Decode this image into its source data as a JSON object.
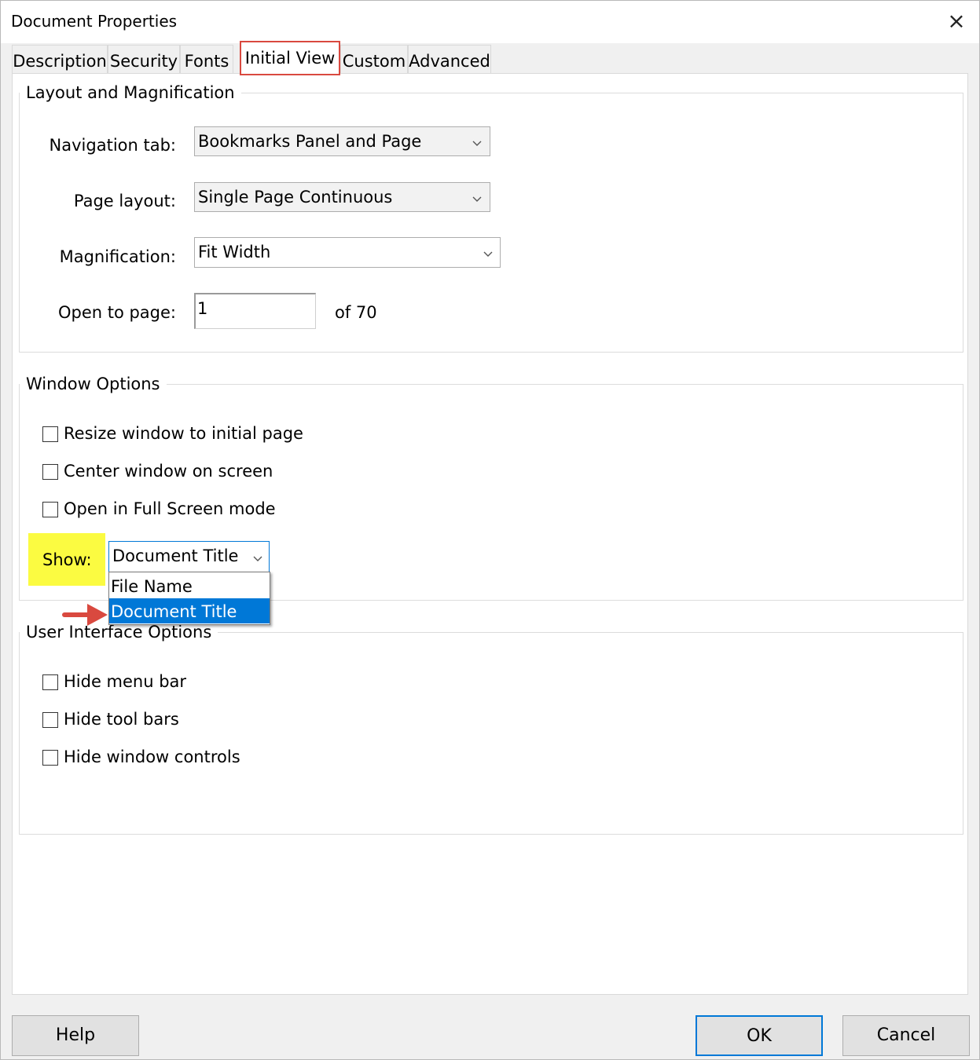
{
  "window": {
    "title": "Document Properties",
    "close_label": "×"
  },
  "tabs": [
    {
      "label": "Description"
    },
    {
      "label": "Security"
    },
    {
      "label": "Fonts"
    },
    {
      "label": "Initial View",
      "active": true
    },
    {
      "label": "Custom"
    },
    {
      "label": "Advanced"
    }
  ],
  "layout_group": {
    "title": "Layout and Magnification",
    "navigation_tab": {
      "label": "Navigation tab:",
      "value": "Bookmarks Panel and Page"
    },
    "page_layout": {
      "label": "Page layout:",
      "value": "Single Page Continuous"
    },
    "magnification": {
      "label": "Magnification:",
      "value": "Fit Width"
    },
    "open_to_page": {
      "label": "Open to page:",
      "value": "1",
      "total_text": "of 70"
    }
  },
  "window_group": {
    "title": "Window Options",
    "checkboxes": [
      {
        "label": "Resize window to initial page",
        "checked": false
      },
      {
        "label": "Center window on screen",
        "checked": false
      },
      {
        "label": "Open in Full Screen mode",
        "checked": false
      }
    ],
    "show": {
      "label": "Show:",
      "value": "Document Title",
      "options": [
        "File Name",
        "Document Title"
      ],
      "highlight_color": "#fbfb41"
    }
  },
  "ui_group": {
    "title": "User Interface Options",
    "checkboxes": [
      {
        "label": "Hide menu bar",
        "checked": false
      },
      {
        "label": "Hide tool bars",
        "checked": false
      },
      {
        "label": "Hide window controls",
        "checked": false
      }
    ]
  },
  "buttons": {
    "help": "Help",
    "ok": "OK",
    "cancel": "Cancel"
  },
  "colors": {
    "accent": "#0078d7",
    "annotation_red": "#d9493f"
  },
  "icons": {
    "close": "close-icon",
    "dropdown": "chevron-down-icon",
    "annotation": "red-arrow-icon"
  }
}
